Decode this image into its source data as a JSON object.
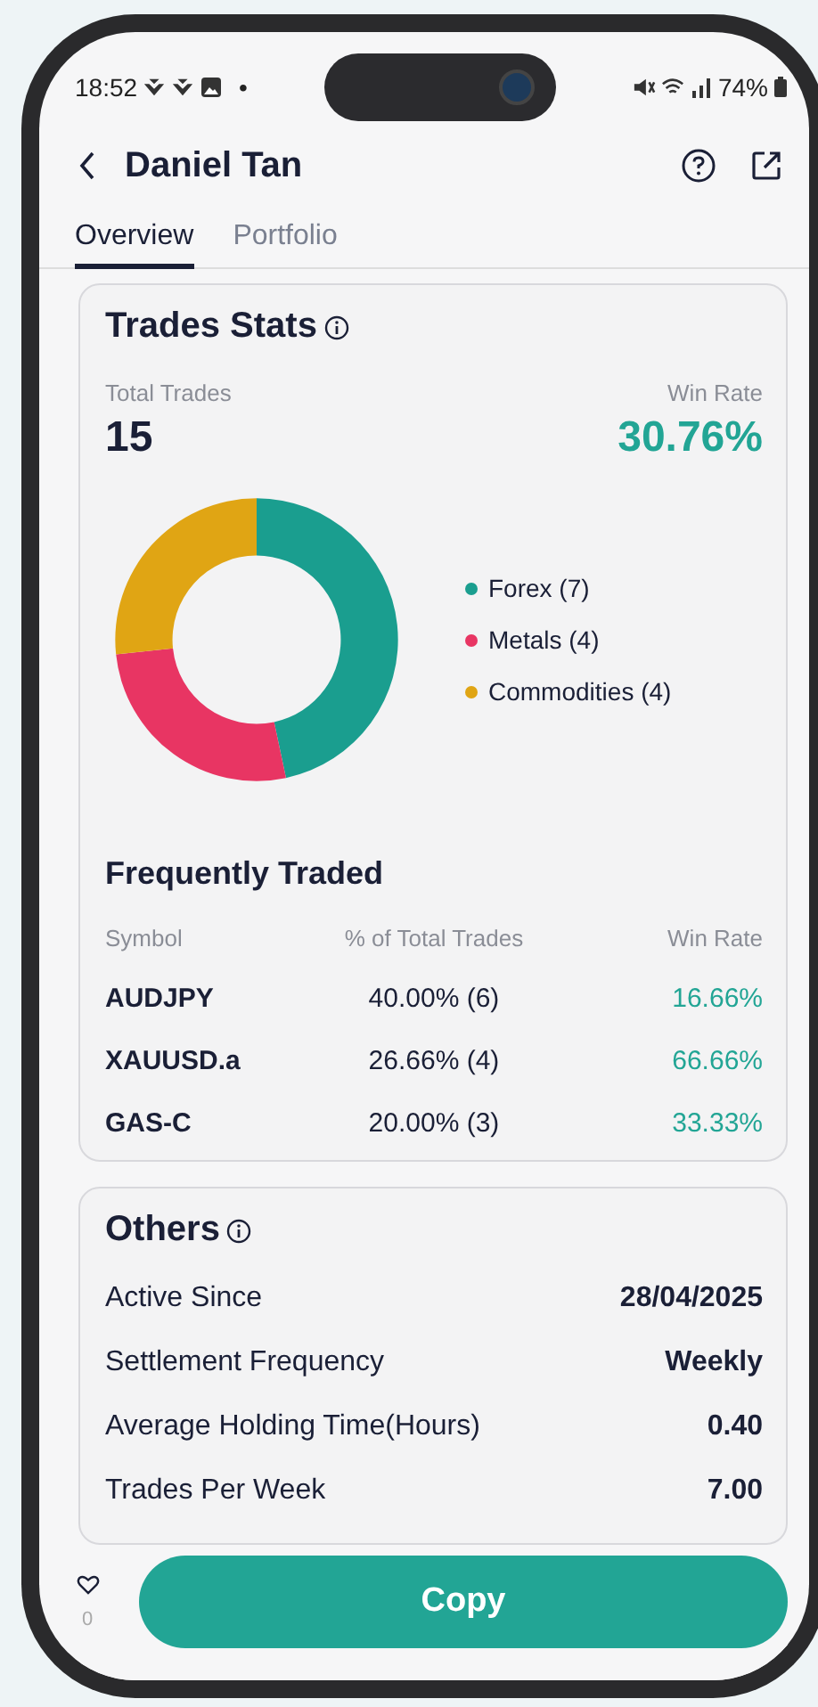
{
  "status_bar": {
    "time": "18:52",
    "dot": "•",
    "battery": "74%"
  },
  "header": {
    "title": "Daniel Tan"
  },
  "tabs": [
    {
      "label": "Overview",
      "selected": true
    },
    {
      "label": "Portfolio",
      "selected": false
    }
  ],
  "trade_stats": {
    "title": "Trades Stats",
    "total_label": "Total Trades",
    "total": "15",
    "win_label": "Win Rate",
    "win_rate": "30.76%",
    "chart_data": {
      "type": "donut",
      "categories": [
        "Forex (7)",
        "Metals (4)",
        "Commodities (4)"
      ],
      "values": [
        7,
        4,
        4
      ]
    },
    "legend": [
      {
        "color": "#1a9e8f"
      },
      {
        "color": "#e83563"
      },
      {
        "color": "#e0a514"
      }
    ]
  },
  "frequently_traded": {
    "title": "Frequently Traded",
    "columns": [
      "Symbol",
      "% of Total Trades",
      "Win Rate"
    ],
    "rows": [
      {
        "symbol": "AUDJPY",
        "share": "40.00% (6)",
        "win_rate": "16.66%"
      },
      {
        "symbol": "XAUUSD.a",
        "share": "26.66% (4)",
        "win_rate": "66.66%"
      },
      {
        "symbol": "GAS-C",
        "share": "20.00% (3)",
        "win_rate": "33.33%"
      }
    ]
  },
  "others": {
    "title": "Others",
    "rows": [
      {
        "label": "Active Since",
        "value": "28/04/2025"
      },
      {
        "label": "Settlement Frequency",
        "value": "Weekly"
      },
      {
        "label": "Average Holding Time(Hours)",
        "value": "0.40"
      },
      {
        "label": "Trades Per Week",
        "value": "7.00"
      }
    ]
  },
  "footer": {
    "likes": "0",
    "button": "Copy"
  }
}
